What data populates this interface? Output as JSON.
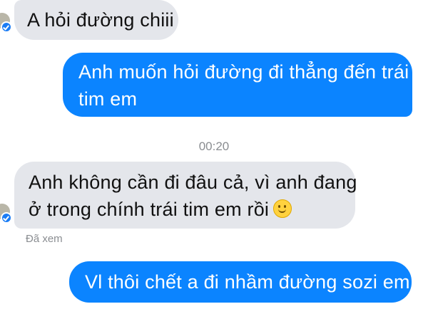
{
  "conversation": {
    "messages": [
      {
        "sender": "incoming",
        "lines": [
          "A hỏi đường chiii"
        ]
      },
      {
        "sender": "outgoing",
        "lines": [
          "Anh muốn hỏi đường đi thẳng đến trái",
          "tim em"
        ]
      },
      {
        "sender": "incoming",
        "lines": [
          "Anh không cần đi đâu cả, vì anh đang",
          "ở trong chính trái tim em rồi"
        ],
        "emoji": "slightly-smiling-face-icon"
      },
      {
        "sender": "outgoing",
        "lines": [
          "Vl thôi chết a đi nhầm đường sozi em"
        ]
      }
    ],
    "timestamp": "00:20",
    "seen_status": "Đã xem"
  },
  "colors": {
    "outgoing_bubble": "#0b84ff",
    "incoming_bubble": "#e4e6eb",
    "seen_badge": "#1a7cf5"
  }
}
